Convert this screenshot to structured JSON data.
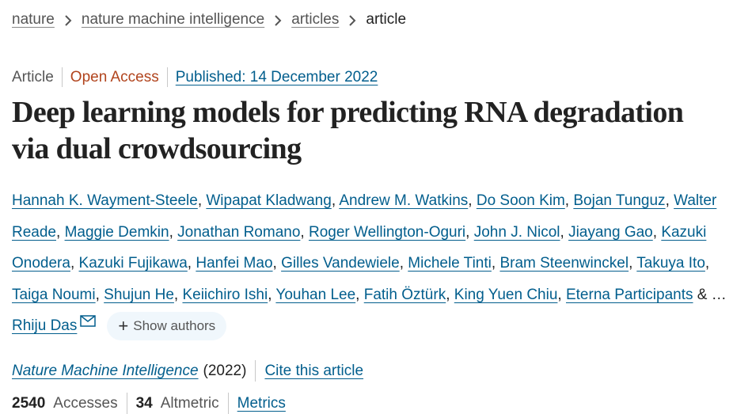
{
  "breadcrumb": {
    "items": [
      "nature",
      "nature machine intelligence",
      "articles"
    ],
    "current": "article"
  },
  "meta": {
    "type": "Article",
    "access": "Open Access",
    "published": "Published: 14 December 2022"
  },
  "title": {
    "line1": "Deep learning models for predicting RNA degradation",
    "line2": "via dual crowdsourcing"
  },
  "authors": {
    "list": [
      "Hannah K. Wayment-Steele",
      "Wipapat Kladwang",
      "Andrew M. Watkins",
      "Do Soon Kim",
      "Bojan Tunguz",
      "Walter Reade",
      "Maggie Demkin",
      "Jonathan Romano",
      "Roger Wellington-Oguri",
      "John J. Nicol",
      "Jiayang Gao",
      "Kazuki Onodera",
      "Kazuki Fujikawa",
      "Hanfei Mao",
      "Gilles Vandewiele",
      "Michele Tinti",
      "Bram Steenwinckel",
      "Takuya Ito",
      "Taiga Noumi",
      "Shujun He",
      "Keiichiro Ishi",
      "Youhan Lee",
      "Fatih Öztürk",
      "King Yuen Chiu",
      "Eterna Participants"
    ],
    "ellipsis": "& …",
    "last": "Rhiju Das",
    "show_authors": "Show authors"
  },
  "journal": {
    "name": "Nature Machine Intelligence",
    "year": "(2022)",
    "cite": "Cite this article"
  },
  "metrics": {
    "accesses_value": "2540",
    "accesses_label": "Accesses",
    "altmetric_value": "34",
    "altmetric_label": "Altmetric",
    "metrics_link": "Metrics"
  },
  "colors": {
    "link": "#025e8d",
    "open_access": "#b1441d",
    "text": "#222222",
    "muted": "#555555",
    "pill_bg": "#f0f7fc"
  },
  "icons": [
    "chevron-right-icon",
    "mail-icon",
    "plus-icon"
  ]
}
